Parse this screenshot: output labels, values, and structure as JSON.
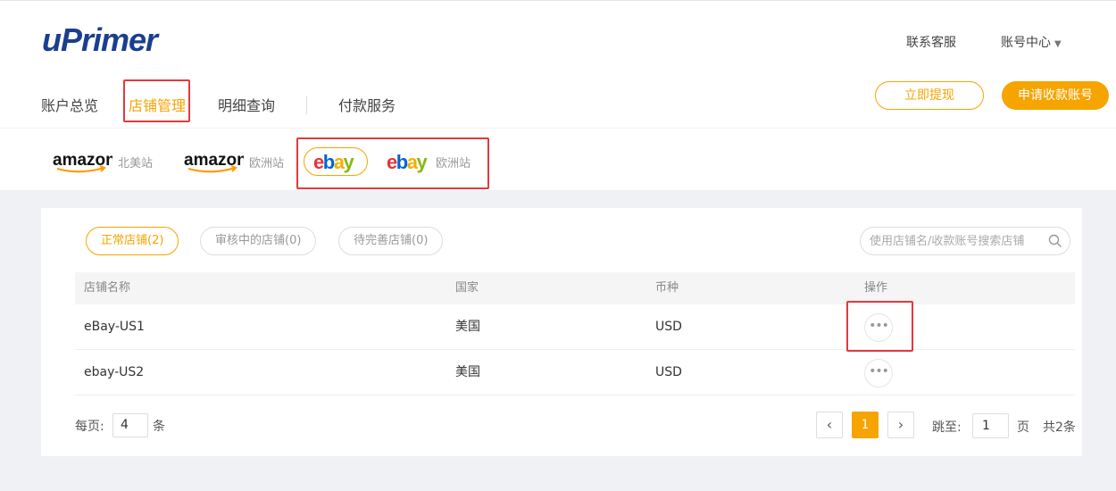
{
  "brand": {
    "logo_text": "uPrimer",
    "primary_color": "#f5a400",
    "alert_color": "#e4393c"
  },
  "top_links": {
    "support": "联系客服",
    "account_center": "账号中心"
  },
  "nav": [
    {
      "label": "账户总览"
    },
    {
      "label": "店铺管理",
      "active": true
    },
    {
      "label": "明细查询"
    },
    {
      "label": "付款服务"
    }
  ],
  "actions": {
    "withdraw": "立即提现",
    "apply_account": "申请收款账号"
  },
  "platforms": [
    {
      "logo": "amazon",
      "suffix": "北美站"
    },
    {
      "logo": "amazon",
      "suffix": "欧洲站"
    },
    {
      "logo": "ebay",
      "suffix": "",
      "active": true
    },
    {
      "logo": "ebay",
      "suffix": "欧洲站"
    }
  ],
  "status_tabs": [
    {
      "label": "正常店铺(2)",
      "active": true
    },
    {
      "label": "审核中的店铺(0)"
    },
    {
      "label": "待完善店铺(0)"
    }
  ],
  "search": {
    "placeholder": "使用店铺名/收款账号搜索店铺",
    "icon": "search-icon"
  },
  "table": {
    "columns": [
      "店铺名称",
      "国家",
      "币种",
      "操作"
    ],
    "rows": [
      {
        "name": "eBay-US1",
        "country": "美国",
        "currency": "USD",
        "action": "•••"
      },
      {
        "name": "ebay-US2",
        "country": "美国",
        "currency": "USD",
        "action": "•••"
      }
    ]
  },
  "pagination": {
    "per_page_label": "每页:",
    "per_page": "4",
    "per_page_unit": "条",
    "prev": "‹",
    "current_page": "1",
    "next": "›",
    "jump_label": "跳至:",
    "jump_value": "1",
    "page_unit": "页",
    "total": "共2条"
  }
}
